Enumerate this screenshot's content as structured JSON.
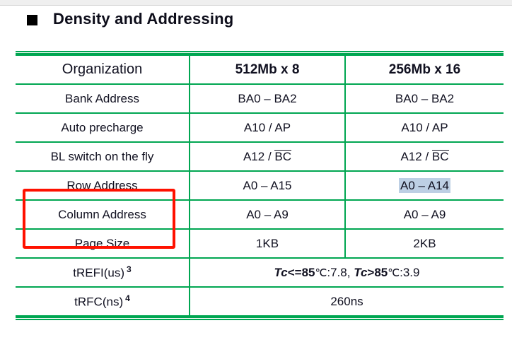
{
  "slide": {
    "title": "Density and Addressing",
    "bullet_icon": "filled-square-bullet-icon"
  },
  "table": {
    "header": {
      "label": "Organization",
      "col1": "512Mb x 8",
      "col2": "256Mb x 16"
    },
    "rows": [
      {
        "label": "Bank Address",
        "col1": "BA0 – BA2",
        "col2": "BA0 – BA2"
      },
      {
        "label": "Auto precharge",
        "col1": "A10 / AP",
        "col2": "A10 / AP"
      },
      {
        "label": "BL switch on the fly",
        "col1_prefix": "A12 / ",
        "col1_overline": "BC",
        "col2_prefix": "A12 / ",
        "col2_overline": "BC"
      },
      {
        "label": "Row Address",
        "col1": "A0 – A15",
        "col2": "A0 – A14",
        "col2_selected": true
      },
      {
        "label": "Column Address",
        "col1": "A0 – A9",
        "col2": "A0 – A9"
      },
      {
        "label": "Page Size",
        "col1": "1KB",
        "col2": "2KB"
      }
    ],
    "spanned_rows": [
      {
        "label": "tREFI(us)",
        "label_sup": "3",
        "value_part1_italic": "Tc",
        "value_part2": "<=85",
        "value_deg1": "℃",
        "value_part3": ":7.8, ",
        "value_part4_italic": "Tc",
        "value_part5": ">85",
        "value_deg2": "℃",
        "value_part6": ":3.9"
      },
      {
        "label": "tRFC(ns)",
        "label_sup": "4",
        "value": "260ns"
      }
    ]
  },
  "annotations": {
    "red_box": {
      "name": "red-highlight-box",
      "color": "#ff1100",
      "covers": [
        "Row Address",
        "Column Address"
      ]
    },
    "text_selection": {
      "name": "text-selection-highlight",
      "color": "#bdcfe4",
      "text": "A0 – A14"
    }
  },
  "colors": {
    "label_fill": "#c9f03e",
    "border_green": "#00a651",
    "red": "#ff1100",
    "selection_blue": "#bdcfe4"
  }
}
